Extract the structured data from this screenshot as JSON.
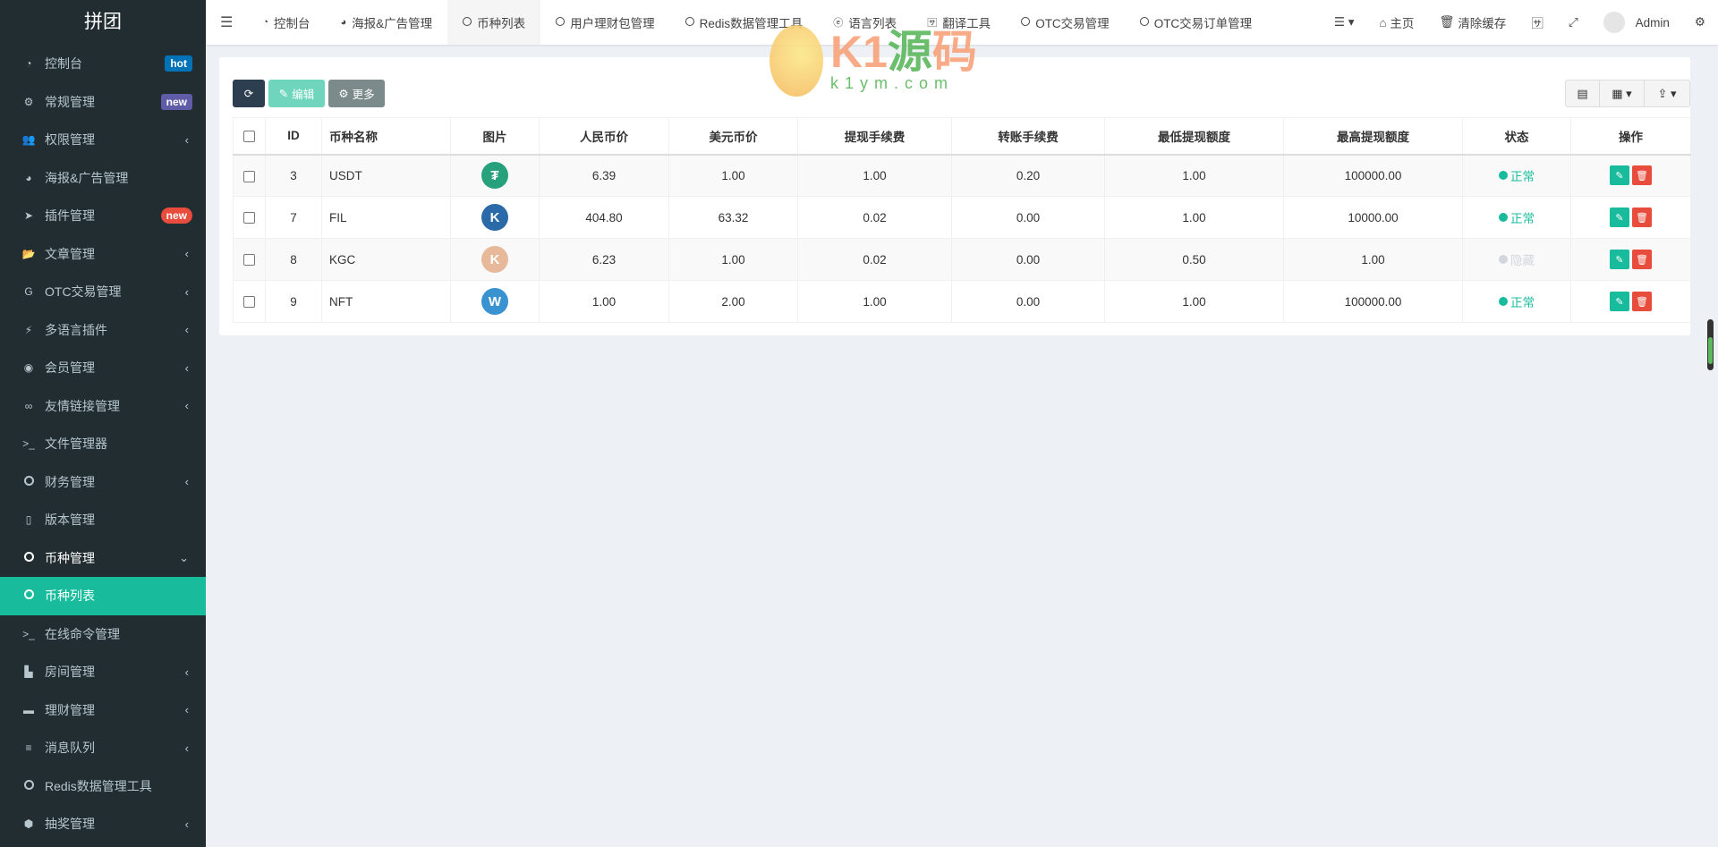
{
  "sidebar": {
    "logo": "拼团",
    "items": [
      {
        "label": "控制台",
        "icon": "dashboard-icon",
        "badge": "hot"
      },
      {
        "label": "常规管理",
        "icon": "cogs-icon",
        "badge": "new"
      },
      {
        "label": "权限管理",
        "icon": "users-icon",
        "chevron": true
      },
      {
        "label": "海报&广告管理",
        "icon": "pie-chart-icon"
      },
      {
        "label": "插件管理",
        "icon": "rocket-icon",
        "badge": "new"
      },
      {
        "label": "文章管理",
        "icon": "folder-open-icon",
        "chevron": true
      },
      {
        "label": "OTC交易管理",
        "icon": "google-plus-icon",
        "chevron": true
      },
      {
        "label": "多语言插件",
        "icon": "plug-icon",
        "chevron": true
      },
      {
        "label": "会员管理",
        "icon": "user-circle-icon",
        "chevron": true
      },
      {
        "label": "友情链接管理",
        "icon": "link-icon",
        "chevron": true
      },
      {
        "label": "文件管理器",
        "icon": "terminal-icon"
      },
      {
        "label": "财务管理",
        "icon": "circle-icon",
        "chevron": true
      },
      {
        "label": "版本管理",
        "icon": "file-text-icon"
      },
      {
        "label": "币种管理",
        "icon": "circle-icon",
        "chevron": true
      },
      {
        "label": "币种列表",
        "icon": "circle-icon"
      },
      {
        "label": "在线命令管理",
        "icon": "terminal-icon"
      },
      {
        "label": "房间管理",
        "icon": "industry-icon",
        "chevron": true
      },
      {
        "label": "理财管理",
        "icon": "visa-icon",
        "chevron": true
      },
      {
        "label": "消息队列",
        "icon": "list-icon",
        "chevron": true
      },
      {
        "label": "Redis数据管理工具",
        "icon": "circle-icon"
      },
      {
        "label": "抽奖管理",
        "icon": "cube-icon",
        "chevron": true
      }
    ]
  },
  "header": {
    "tabs": [
      "控制台",
      "海报&广告管理",
      "币种列表",
      "用户理财包管理",
      "Redis数据管理工具",
      "语言列表",
      "翻译工具",
      "OTC交易管理",
      "OTC交易订单管理"
    ],
    "home": "主页",
    "clear_cache": "清除缓存",
    "user": "Admin"
  },
  "toolbar": {
    "edit": "编辑",
    "more": "更多"
  },
  "table": {
    "columns": [
      "ID",
      "币种名称",
      "图片",
      "人民币价",
      "美元币价",
      "提现手续费",
      "转账手续费",
      "最低提现额度",
      "最高提现额度",
      "状态",
      "操作"
    ],
    "rows": [
      {
        "id": "3",
        "name": "USDT",
        "cny": "6.39",
        "usd": "1.00",
        "withdraw_fee": "1.00",
        "transfer_fee": "0.20",
        "min": "1.00",
        "max": "100000.00",
        "status": "正常"
      },
      {
        "id": "7",
        "name": "FIL",
        "cny": "404.80",
        "usd": "63.32",
        "withdraw_fee": "0.02",
        "transfer_fee": "0.00",
        "min": "1.00",
        "max": "10000.00",
        "status": "正常"
      },
      {
        "id": "8",
        "name": "KGC",
        "cny": "6.23",
        "usd": "1.00",
        "withdraw_fee": "0.02",
        "transfer_fee": "0.00",
        "min": "0.50",
        "max": "1.00",
        "status": "隐藏"
      },
      {
        "id": "9",
        "name": "NFT",
        "cny": "1.00",
        "usd": "2.00",
        "withdraw_fee": "1.00",
        "transfer_fee": "0.00",
        "min": "1.00",
        "max": "100000.00",
        "status": "正常"
      }
    ]
  },
  "colors": {
    "sidebar": "#222d32",
    "accent": "#18bc9c",
    "danger": "#e74c3c",
    "hidden": "#d2d6de"
  },
  "watermark": {
    "brand": "K1源码",
    "url": "k1ym.com"
  }
}
